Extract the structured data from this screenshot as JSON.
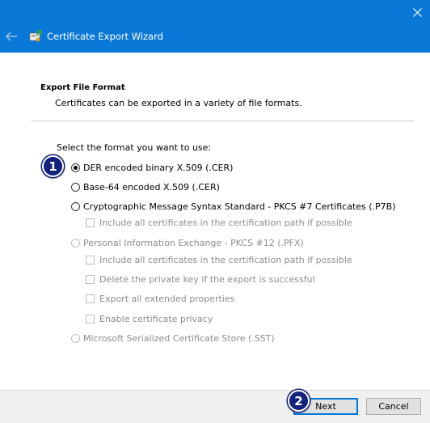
{
  "window": {
    "title": "Certificate Export Wizard",
    "accent_color": "#0a78d7",
    "close_icon": "close-icon",
    "back_icon": "back-arrow-icon",
    "app_icon": "certificate-icon"
  },
  "page": {
    "section_title": "Export File Format",
    "section_description": "Certificates can be exported in a variety of file formats.",
    "prompt": "Select the format you want to use:"
  },
  "options": {
    "der": {
      "label": "DER encoded binary X.509 (.CER)",
      "selected": true,
      "enabled": true
    },
    "base64": {
      "label": "Base-64 encoded X.509 (.CER)",
      "selected": false,
      "enabled": true
    },
    "pkcs7": {
      "label": "Cryptographic Message Syntax Standard - PKCS #7 Certificates (.P7B)",
      "selected": false,
      "enabled": true
    },
    "pkcs7_include_all": {
      "label": "Include all certificates in the certification path if possible",
      "checked": false,
      "enabled": false
    },
    "pfx": {
      "label": "Personal Information Exchange - PKCS #12 (.PFX)",
      "selected": false,
      "enabled": false
    },
    "pfx_include_all": {
      "label": "Include all certificates in the certification path if possible",
      "checked": false,
      "enabled": false
    },
    "pfx_delete_key": {
      "label": "Delete the private key if the export is successful",
      "checked": false,
      "enabled": false
    },
    "pfx_export_ext": {
      "label": "Export all extended properties",
      "checked": false,
      "enabled": false
    },
    "pfx_privacy": {
      "label": "Enable certificate privacy",
      "checked": false,
      "enabled": false
    },
    "sst": {
      "label": "Microsoft Serialized Certificate Store (.SST)",
      "selected": false,
      "enabled": false
    }
  },
  "annotations": {
    "step1": "1",
    "step2": "2",
    "badge_color": "#13227a"
  },
  "footer": {
    "next_label": "Next",
    "cancel_label": "Cancel"
  }
}
